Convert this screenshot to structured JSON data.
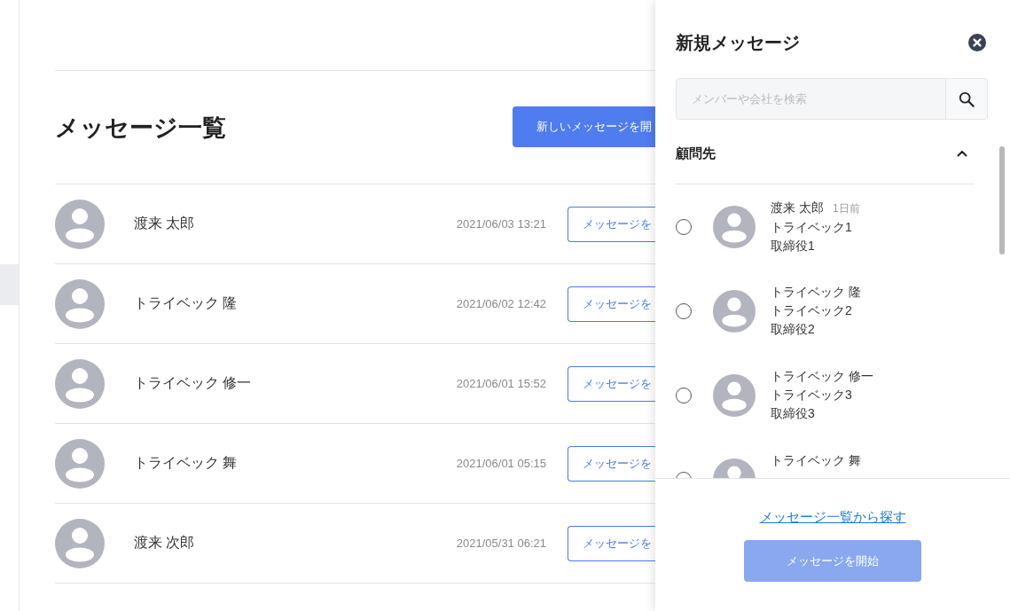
{
  "page": {
    "title": "メッセージ一覧",
    "new_message_button": "新しいメッセージを開"
  },
  "messages": [
    {
      "name": "渡来 太郎",
      "date": "2021/06/03 13:21",
      "button": "メッセージを"
    },
    {
      "name": "トライベック 隆",
      "date": "2021/06/02 12:42",
      "button": "メッセージを"
    },
    {
      "name": "トライベック 修一",
      "date": "2021/06/01 15:52",
      "button": "メッセージを"
    },
    {
      "name": "トライベック 舞",
      "date": "2021/06/01 05:15",
      "button": "メッセージを"
    },
    {
      "name": "渡来 次郎",
      "date": "2021/05/31 06:21",
      "button": "メッセージを"
    }
  ],
  "panel": {
    "title": "新規メッセージ",
    "search": {
      "placeholder": "メンバーや会社を検索"
    },
    "section": {
      "title": "顧問先",
      "expanded": true
    },
    "contacts": [
      {
        "name": "渡来 太郎",
        "time": "1日前",
        "company": "トライベック1",
        "role": "取締役1",
        "selected": false
      },
      {
        "name": "トライベック 隆",
        "company": "トライベック2",
        "role": "取締役2",
        "selected": false
      },
      {
        "name": "トライベック 修一",
        "company": "トライベック3",
        "role": "取締役3",
        "selected": false
      },
      {
        "name": "トライベック 舞",
        "selected": false
      }
    ],
    "link": "メッセージ一覧から探す",
    "start_button": {
      "label": "メッセージを開始",
      "disabled": true
    }
  }
}
